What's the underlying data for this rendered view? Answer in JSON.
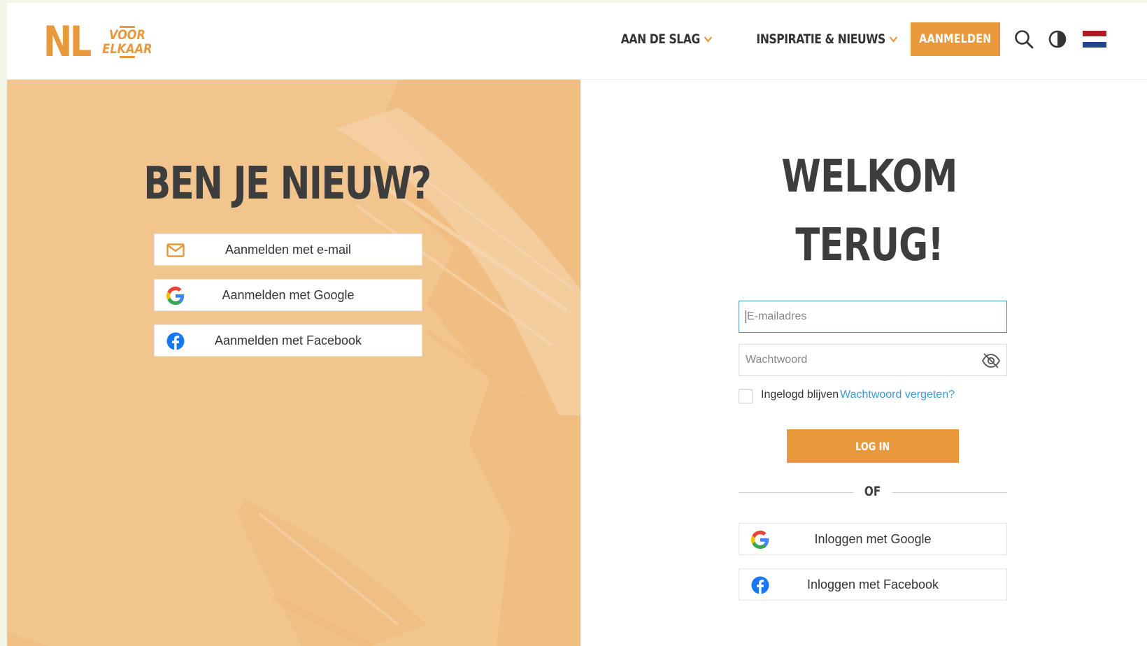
{
  "header": {
    "logo_main": "NL",
    "logo_sub_line1": "VOOR",
    "logo_sub_line2": "ELKAAR",
    "nav": [
      {
        "label": "AAN DE SLAG"
      },
      {
        "label": "INSPIRATIE & NIEUWS"
      }
    ],
    "signup_label": "AANMELDEN",
    "icons": [
      "search-icon",
      "contrast-icon",
      "dutch-flag-icon"
    ]
  },
  "left_panel": {
    "title": "BEN JE NIEUW?",
    "buttons": [
      {
        "label": "Aanmelden met e-mail",
        "icon": "mail-icon"
      },
      {
        "label": "Aanmelden met Google",
        "icon": "google-icon"
      },
      {
        "label": "Aanmelden met Facebook",
        "icon": "facebook-icon"
      }
    ]
  },
  "login": {
    "title_line1": "WELKOM",
    "title_line2": "TERUG!",
    "email_placeholder": "E-mailadres",
    "password_placeholder": "Wachtwoord",
    "remember_label": "Ingelogd blijven",
    "forgot_label": "Wachtwoord vergeten?",
    "submit_label": "LOG IN",
    "or_label": "OF",
    "social": [
      {
        "label": "Inloggen met Google",
        "icon": "google-icon"
      },
      {
        "label": "Inloggen met Facebook",
        "icon": "facebook-icon"
      }
    ]
  },
  "colors": {
    "brand_orange": "#e8993b",
    "panel_peach": "#f2c58f",
    "link_blue": "#3b9bd6",
    "heading_dark": "#3d3d3d",
    "flag_red": "#ae1c28",
    "flag_blue": "#21468b"
  }
}
